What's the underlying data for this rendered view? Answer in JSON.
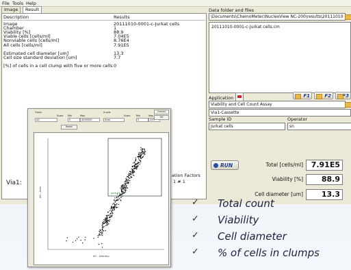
{
  "menu": [
    "File",
    "Tools",
    "Help"
  ],
  "tabs": [
    {
      "label": "Image"
    },
    {
      "label": "Result"
    }
  ],
  "results": {
    "header_desc": "Description",
    "header_val": "Results",
    "rows": [
      {
        "d": "Image",
        "v": "20111010-0001-c-Jurkat cells"
      },
      {
        "d": "Chamber",
        "v": "1"
      },
      {
        "d": "Viability [%]",
        "v": "88.9"
      },
      {
        "d": "Viable cells [cells/ml]",
        "v": "7.04E5"
      },
      {
        "d": "Nonviable cells [cells/ml]",
        "v": "8.76E4"
      },
      {
        "d": "All cells [cells/ml]",
        "v": "7.91E5"
      },
      {
        "d": "",
        "v": ""
      },
      {
        "d": "Estimated cell diameter [um]",
        "v": "13.3"
      },
      {
        "d": "Cell size standard deviation [um]",
        "v": "7.7"
      },
      {
        "d": "",
        "v": ""
      },
      {
        "d": "[%] of cells in a cell clump with five or more cells",
        "v": "0"
      }
    ]
  },
  "data_folder": {
    "label": "Data folder and files",
    "path": "\\Documents\\ChemoMetec\\NucleoView NC-200\\results\\20111010",
    "file": "20111010-0001-c-Jurkat cells.cm"
  },
  "application": {
    "label": "Application",
    "value": "Viability and Cell Count Assay",
    "cassette": "Via1-Cassette",
    "f_buttons": [
      "F1",
      "F2",
      "F3"
    ]
  },
  "sample": {
    "label": "Sample ID",
    "value": "Jurkat cells"
  },
  "operator": {
    "label": "Operator",
    "value": "sn"
  },
  "run_label": "RUN",
  "readouts": [
    {
      "label": "Total [cells/ml]",
      "value": "7.91E5"
    },
    {
      "label": "Viability [%]",
      "value": "88.9"
    },
    {
      "label": "Cell diameter [um]",
      "value": "13.3"
    }
  ],
  "left_label": "Via1:",
  "factors": {
    "label": "ation Factors",
    "value": "1 # 1"
  },
  "popup": {
    "y_label": "Y-axis",
    "x_label": "X-axis",
    "y_opt": "AO",
    "x_opt": "Area",
    "scale_lbl": "Scale",
    "min_lbl": "Min",
    "max_lbl": "Max",
    "cancel": "Cancel",
    "ok": "OK",
    "reset": "Reset",
    "y_min": "0",
    "y_max": "4000000",
    "x_min": "0",
    "x_max": "200",
    "gate_label": "gate 93.1 %",
    "x_axis_title": "AO - Intensity",
    "y_axis_title": "AO - Area"
  },
  "checklist": [
    "Total count",
    "Viability",
    "Cell diameter",
    "% of cells in clumps"
  ]
}
